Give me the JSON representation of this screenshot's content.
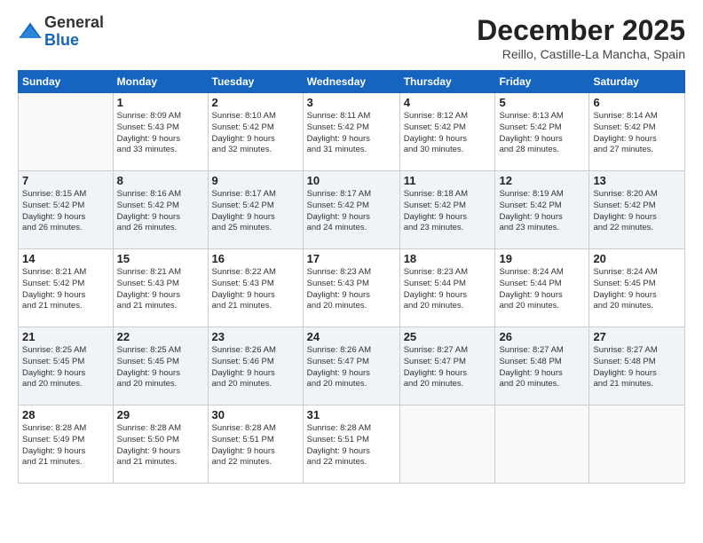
{
  "logo": {
    "general": "General",
    "blue": "Blue"
  },
  "title": "December 2025",
  "subtitle": "Reillo, Castille-La Mancha, Spain",
  "calendar": {
    "headers": [
      "Sunday",
      "Monday",
      "Tuesday",
      "Wednesday",
      "Thursday",
      "Friday",
      "Saturday"
    ],
    "weeks": [
      [
        {
          "day": "",
          "info": ""
        },
        {
          "day": "1",
          "info": "Sunrise: 8:09 AM\nSunset: 5:43 PM\nDaylight: 9 hours\nand 33 minutes."
        },
        {
          "day": "2",
          "info": "Sunrise: 8:10 AM\nSunset: 5:42 PM\nDaylight: 9 hours\nand 32 minutes."
        },
        {
          "day": "3",
          "info": "Sunrise: 8:11 AM\nSunset: 5:42 PM\nDaylight: 9 hours\nand 31 minutes."
        },
        {
          "day": "4",
          "info": "Sunrise: 8:12 AM\nSunset: 5:42 PM\nDaylight: 9 hours\nand 30 minutes."
        },
        {
          "day": "5",
          "info": "Sunrise: 8:13 AM\nSunset: 5:42 PM\nDaylight: 9 hours\nand 28 minutes."
        },
        {
          "day": "6",
          "info": "Sunrise: 8:14 AM\nSunset: 5:42 PM\nDaylight: 9 hours\nand 27 minutes."
        }
      ],
      [
        {
          "day": "7",
          "info": "Sunrise: 8:15 AM\nSunset: 5:42 PM\nDaylight: 9 hours\nand 26 minutes."
        },
        {
          "day": "8",
          "info": "Sunrise: 8:16 AM\nSunset: 5:42 PM\nDaylight: 9 hours\nand 26 minutes."
        },
        {
          "day": "9",
          "info": "Sunrise: 8:17 AM\nSunset: 5:42 PM\nDaylight: 9 hours\nand 25 minutes."
        },
        {
          "day": "10",
          "info": "Sunrise: 8:17 AM\nSunset: 5:42 PM\nDaylight: 9 hours\nand 24 minutes."
        },
        {
          "day": "11",
          "info": "Sunrise: 8:18 AM\nSunset: 5:42 PM\nDaylight: 9 hours\nand 23 minutes."
        },
        {
          "day": "12",
          "info": "Sunrise: 8:19 AM\nSunset: 5:42 PM\nDaylight: 9 hours\nand 23 minutes."
        },
        {
          "day": "13",
          "info": "Sunrise: 8:20 AM\nSunset: 5:42 PM\nDaylight: 9 hours\nand 22 minutes."
        }
      ],
      [
        {
          "day": "14",
          "info": "Sunrise: 8:21 AM\nSunset: 5:42 PM\nDaylight: 9 hours\nand 21 minutes."
        },
        {
          "day": "15",
          "info": "Sunrise: 8:21 AM\nSunset: 5:43 PM\nDaylight: 9 hours\nand 21 minutes."
        },
        {
          "day": "16",
          "info": "Sunrise: 8:22 AM\nSunset: 5:43 PM\nDaylight: 9 hours\nand 21 minutes."
        },
        {
          "day": "17",
          "info": "Sunrise: 8:23 AM\nSunset: 5:43 PM\nDaylight: 9 hours\nand 20 minutes."
        },
        {
          "day": "18",
          "info": "Sunrise: 8:23 AM\nSunset: 5:44 PM\nDaylight: 9 hours\nand 20 minutes."
        },
        {
          "day": "19",
          "info": "Sunrise: 8:24 AM\nSunset: 5:44 PM\nDaylight: 9 hours\nand 20 minutes."
        },
        {
          "day": "20",
          "info": "Sunrise: 8:24 AM\nSunset: 5:45 PM\nDaylight: 9 hours\nand 20 minutes."
        }
      ],
      [
        {
          "day": "21",
          "info": "Sunrise: 8:25 AM\nSunset: 5:45 PM\nDaylight: 9 hours\nand 20 minutes."
        },
        {
          "day": "22",
          "info": "Sunrise: 8:25 AM\nSunset: 5:45 PM\nDaylight: 9 hours\nand 20 minutes."
        },
        {
          "day": "23",
          "info": "Sunrise: 8:26 AM\nSunset: 5:46 PM\nDaylight: 9 hours\nand 20 minutes."
        },
        {
          "day": "24",
          "info": "Sunrise: 8:26 AM\nSunset: 5:47 PM\nDaylight: 9 hours\nand 20 minutes."
        },
        {
          "day": "25",
          "info": "Sunrise: 8:27 AM\nSunset: 5:47 PM\nDaylight: 9 hours\nand 20 minutes."
        },
        {
          "day": "26",
          "info": "Sunrise: 8:27 AM\nSunset: 5:48 PM\nDaylight: 9 hours\nand 20 minutes."
        },
        {
          "day": "27",
          "info": "Sunrise: 8:27 AM\nSunset: 5:48 PM\nDaylight: 9 hours\nand 21 minutes."
        }
      ],
      [
        {
          "day": "28",
          "info": "Sunrise: 8:28 AM\nSunset: 5:49 PM\nDaylight: 9 hours\nand 21 minutes."
        },
        {
          "day": "29",
          "info": "Sunrise: 8:28 AM\nSunset: 5:50 PM\nDaylight: 9 hours\nand 21 minutes."
        },
        {
          "day": "30",
          "info": "Sunrise: 8:28 AM\nSunset: 5:51 PM\nDaylight: 9 hours\nand 22 minutes."
        },
        {
          "day": "31",
          "info": "Sunrise: 8:28 AM\nSunset: 5:51 PM\nDaylight: 9 hours\nand 22 minutes."
        },
        {
          "day": "",
          "info": ""
        },
        {
          "day": "",
          "info": ""
        },
        {
          "day": "",
          "info": ""
        }
      ]
    ]
  }
}
